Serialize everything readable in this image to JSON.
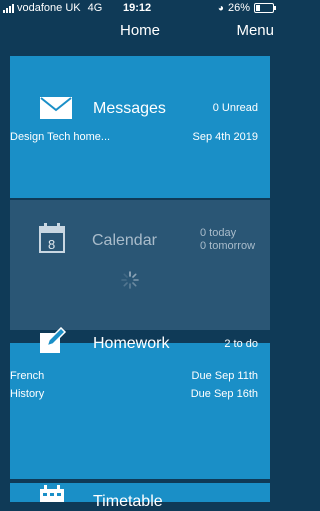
{
  "status_bar": {
    "carrier": "vodafone UK",
    "network": "4G",
    "time": "19:12",
    "battery_percent": "26%",
    "battery_level": 0.26
  },
  "nav": {
    "title": "Home",
    "menu_label": "Menu"
  },
  "tiles": {
    "messages": {
      "title": "Messages",
      "count": "0 Unread",
      "item": {
        "label": "Design Tech home...",
        "date": "Sep 4th 2019"
      }
    },
    "calendar": {
      "title": "Calendar",
      "day_number": "8",
      "today": "0 today",
      "tomorrow": "0 tomorrow"
    },
    "homework": {
      "title": "Homework",
      "count": "2 to do",
      "items": [
        {
          "subject": "French",
          "due": "Due Sep 11th"
        },
        {
          "subject": "History",
          "due": "Due Sep 16th"
        }
      ]
    },
    "timetable": {
      "title": "Timetable"
    }
  },
  "colors": {
    "background": "#0f3a57",
    "tile": "#1a8fc7",
    "tile_loading": "#2a5675"
  },
  "icons": [
    "envelope-icon",
    "calendar-icon",
    "pencil-edit-icon",
    "calendar-grid-icon",
    "loading-spinner-icon"
  ]
}
